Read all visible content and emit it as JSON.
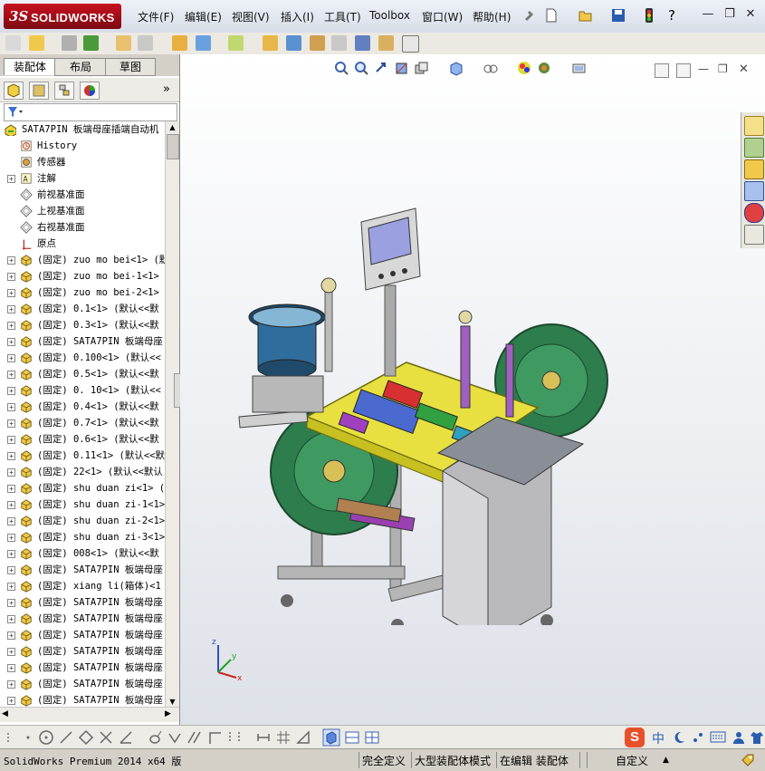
{
  "app": {
    "logo_ds": "3S",
    "logo_text": "SOLIDWORKS",
    "brand_color": "#c8101e"
  },
  "menu": [
    "文件(F)",
    "编辑(E)",
    "视图(V)",
    "插入(I)",
    "工具(T)",
    "Toolbox",
    "窗口(W)",
    "帮助(H)"
  ],
  "window_controls": {
    "minimize": "—",
    "restore": "❐",
    "close": "✕"
  },
  "tabs": [
    "装配体",
    "布局",
    "草图"
  ],
  "tree": {
    "root": "SATA7PIN 板端母座插端自动机",
    "items": [
      {
        "label": "History",
        "icon": "history-icon",
        "expand": false
      },
      {
        "label": "传感器",
        "icon": "sensor-icon",
        "expand": false
      },
      {
        "label": "注解",
        "icon": "annotation-icon",
        "expand": true
      },
      {
        "label": "前视基准面",
        "icon": "plane-icon",
        "expand": false
      },
      {
        "label": "上视基准面",
        "icon": "plane-icon",
        "expand": false
      },
      {
        "label": "右视基准面",
        "icon": "plane-icon",
        "expand": false
      },
      {
        "label": "原点",
        "icon": "origin-icon",
        "expand": false
      },
      {
        "label": "(固定) zuo mo bei<1> (默",
        "icon": "part-icon",
        "expand": true
      },
      {
        "label": "(固定) zuo mo bei-1<1>",
        "icon": "part-icon",
        "expand": true
      },
      {
        "label": "(固定) zuo mo bei-2<1>",
        "icon": "part-icon",
        "expand": true
      },
      {
        "label": "(固定) 0.1<1> (默认<<默",
        "icon": "part-icon",
        "expand": true
      },
      {
        "label": "(固定) 0.3<1> (默认<<默",
        "icon": "part-icon",
        "expand": true
      },
      {
        "label": "(固定) SATA7PIN 板端母座",
        "icon": "part-icon",
        "expand": true
      },
      {
        "label": "(固定) 0.100<1> (默认<<",
        "icon": "part-icon",
        "expand": true
      },
      {
        "label": "(固定) 0.5<1> (默认<<默",
        "icon": "part-icon",
        "expand": true
      },
      {
        "label": "(固定) 0. 10<1> (默认<<",
        "icon": "part-icon",
        "expand": true
      },
      {
        "label": "(固定) 0.4<1> (默认<<默",
        "icon": "part-icon",
        "expand": true
      },
      {
        "label": "(固定) 0.7<1> (默认<<默",
        "icon": "part-icon",
        "expand": true
      },
      {
        "label": "(固定) 0.6<1> (默认<<默",
        "icon": "part-icon",
        "expand": true
      },
      {
        "label": "(固定) 0.11<1> (默认<<默",
        "icon": "part-icon",
        "expand": true
      },
      {
        "label": "(固定) 22<1> (默认<<默认",
        "icon": "part-icon",
        "expand": true
      },
      {
        "label": "(固定) shu duan zi<1> (",
        "icon": "part-icon",
        "expand": true
      },
      {
        "label": "(固定) shu duan zi-1<1>",
        "icon": "part-icon",
        "expand": true
      },
      {
        "label": "(固定) shu duan zi-2<1>",
        "icon": "part-icon",
        "expand": true
      },
      {
        "label": "(固定) shu duan zi-3<1>",
        "icon": "part-icon",
        "expand": true
      },
      {
        "label": "(固定) 008<1> (默认<<默",
        "icon": "part-icon",
        "expand": true
      },
      {
        "label": "(固定) SATA7PIN 板端母座",
        "icon": "part-icon",
        "expand": true
      },
      {
        "label": "(固定) xiang li(箱体)<1",
        "icon": "part-icon",
        "expand": true
      },
      {
        "label": "(固定) SATA7PIN 板端母座",
        "icon": "part-icon",
        "expand": true
      },
      {
        "label": "(固定) SATA7PIN 板端母座",
        "icon": "part-icon",
        "expand": true
      },
      {
        "label": "(固定) SATA7PIN 板端母座",
        "icon": "part-icon",
        "expand": true
      },
      {
        "label": "(固定) SATA7PIN 板端母座",
        "icon": "part-icon",
        "expand": true
      },
      {
        "label": "(固定) SATA7PIN 板端母座",
        "icon": "part-icon",
        "expand": true
      },
      {
        "label": "(固定) SATA7PIN 板端母座",
        "icon": "part-icon",
        "expand": true
      },
      {
        "label": "(固定) SATA7PIN 板端母座",
        "icon": "part-icon",
        "expand": true
      }
    ]
  },
  "triad": {
    "x": "x",
    "y": "y",
    "z": "z"
  },
  "status": {
    "product": "SolidWorks Premium 2014 x64 版",
    "defined": "完全定义",
    "mode": "大型装配体模式",
    "editing": "在编辑 装配体",
    "units": "自定义"
  },
  "ime": {
    "logo": "S",
    "lang": "中"
  }
}
